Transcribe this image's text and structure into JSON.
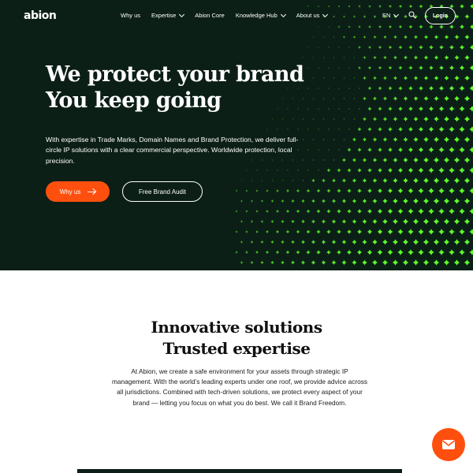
{
  "brand": {
    "logo": "abion",
    "accent": "#ff4f0f",
    "hero_bg": "#0c1f17",
    "dot_color": "#5fff2a"
  },
  "nav": {
    "items": [
      {
        "label": "Why us",
        "has_dropdown": false
      },
      {
        "label": "Expertise",
        "has_dropdown": true
      },
      {
        "label": "Abion Core",
        "has_dropdown": false
      },
      {
        "label": "Knowledge Hub",
        "has_dropdown": true
      },
      {
        "label": "About us",
        "has_dropdown": true
      }
    ],
    "language": "EN",
    "login_label": "Login",
    "search_icon": "search-icon"
  },
  "hero": {
    "title_line1": "We protect your brand",
    "title_line2": "You keep going",
    "description": "With expertise in Trade Marks, Domain Names and Brand Protection, we deliver full-circle IP solutions with a clear commercial perspective. Worldwide protection, local precision.",
    "primary_cta": "Why us",
    "secondary_cta": "Free Brand Audit"
  },
  "intro": {
    "title_line1": "Innovative solutions",
    "title_line2": "Trusted expertise",
    "body": "At Abion, we create a safe environment for your assets through strategic IP management. With the world’s leading experts under one roof, we provide advice across all jurisdictions. Combined with tech-driven solutions, we protect every aspect of your brand — letting you focus on what you do best. We call it Brand Freedom."
  },
  "contact_fab": {
    "icon": "mail-icon"
  }
}
